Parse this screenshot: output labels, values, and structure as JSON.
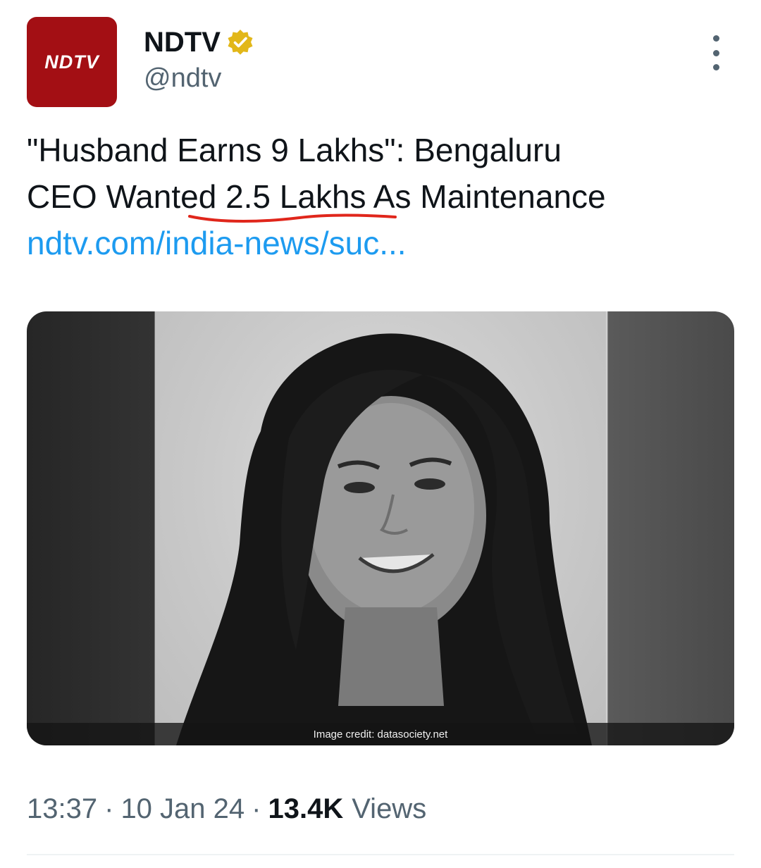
{
  "author": {
    "avatar_text": "NDTV",
    "name": "NDTV",
    "handle": "@ndtv",
    "verified_badge_color": "#e2b719"
  },
  "tweet": {
    "text_line1": "\"Husband Earns 9 Lakhs\": Bengaluru",
    "text_line2": "CEO Wanted 2.5 Lakhs As Maintenance",
    "link_text": "ndtv.com/india-news/suc..."
  },
  "media": {
    "image_credit": "Image credit: datasociety.net"
  },
  "meta": {
    "time": "13:37",
    "date": "10 Jan 24",
    "views_count": "13.4K",
    "views_label": "Views",
    "separator": "·"
  },
  "colors": {
    "link": "#1d9bf0",
    "avatar_bg": "#a30f14",
    "annotation_underline": "#e0261b"
  }
}
